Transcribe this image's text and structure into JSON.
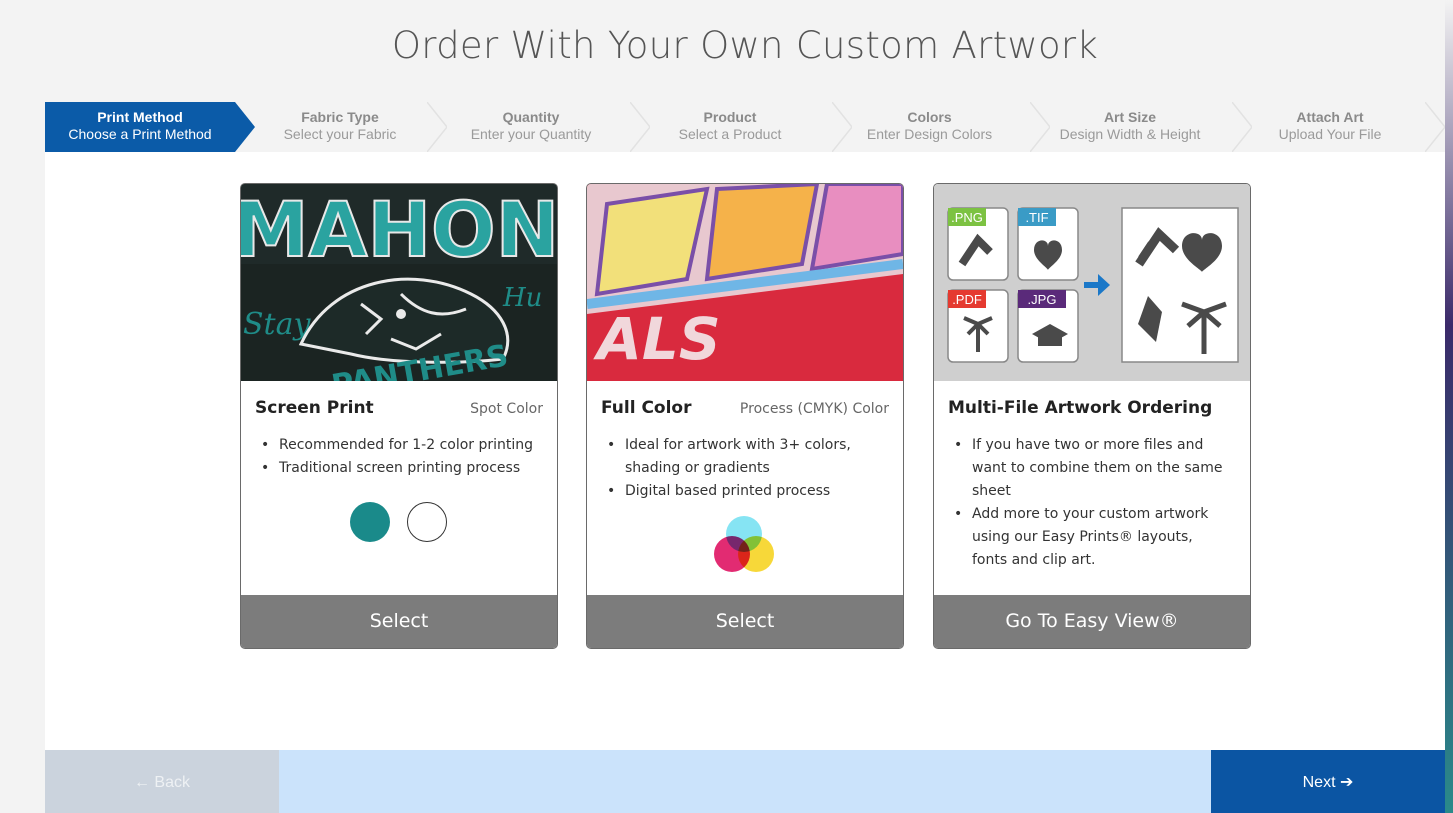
{
  "page": {
    "title": "Order With Your Own Custom Artwork"
  },
  "steps": [
    {
      "title": "Print Method",
      "subtitle": "Choose a Print Method",
      "active": true
    },
    {
      "title": "Fabric Type",
      "subtitle": "Select your Fabric",
      "active": false
    },
    {
      "title": "Quantity",
      "subtitle": "Enter your Quantity",
      "active": false
    },
    {
      "title": "Product",
      "subtitle": "Select a Product",
      "active": false
    },
    {
      "title": "Colors",
      "subtitle": "Enter Design Colors",
      "active": false
    },
    {
      "title": "Art Size",
      "subtitle": "Design Width & Height",
      "active": false
    },
    {
      "title": "Attach Art",
      "subtitle": "Upload Your File",
      "active": false
    }
  ],
  "cards": [
    {
      "title": "Screen Print",
      "tag": "Spot Color",
      "bullets": [
        "Recommended for 1-2 color printing",
        "Traditional screen printing process"
      ],
      "button": "Select",
      "image_text": "MAHONE"
    },
    {
      "title": "Full Color",
      "tag": "Process (CMYK) Color",
      "bullets": [
        "Ideal for artwork with 3+ colors, shading or gradients",
        "Digital based printed process"
      ],
      "button": "Select"
    },
    {
      "title": "Multi-File Artwork Ordering",
      "tag": "",
      "bullets": [
        "If you have two or more files and want to combine them on the same sheet",
        "Add more to your custom artwork using our Easy Prints® layouts, fonts and clip art."
      ],
      "button": "Go To Easy View®",
      "file_types": [
        ".PNG",
        ".TIF",
        ".PDF",
        ".JPG"
      ]
    }
  ],
  "footer": {
    "back": "← Back",
    "next": "Next ➔"
  },
  "colors": {
    "accent": "#0b5ba8",
    "teal_swatch": "#1a8a8a",
    "button_gray": "#7c7c7c",
    "footer_mid": "#cbe3fb"
  }
}
